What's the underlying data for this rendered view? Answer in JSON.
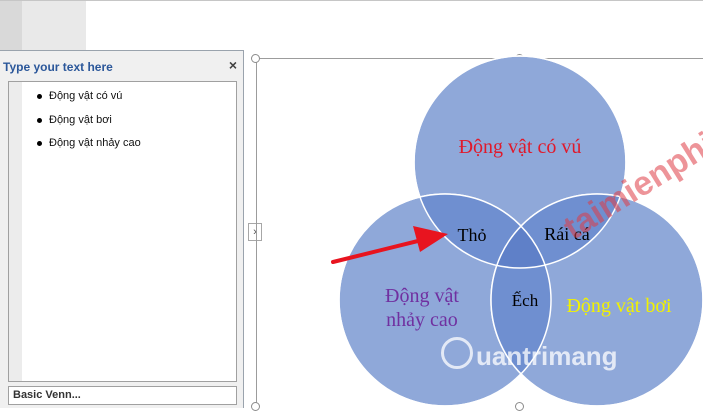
{
  "text_pane": {
    "title": "Type your text here",
    "close_glyph": "×",
    "items": [
      "Động vật có vú",
      "Động vật bơi",
      "Động vật nhảy cao"
    ],
    "footer": "Basic Venn..."
  },
  "expand_glyph": "›",
  "venn": {
    "circles": [
      {
        "label": "Động vật có vú",
        "label_color": "#e0192b"
      },
      {
        "label_line1": "Động vật",
        "label_line2": "nhảy cao",
        "label_color": "#7030a0"
      },
      {
        "label": "Động vật bơi",
        "label_color": "#f2f200"
      }
    ],
    "overlaps": {
      "top_left": "Thỏ",
      "top_right": "Rái cá",
      "center": "Ếch"
    },
    "fill_color": "#8fa8d9",
    "overlap_color": "#6f8fd0"
  },
  "watermark": {
    "top": "taimienphi.top",
    "bottom": "uantrimang"
  }
}
